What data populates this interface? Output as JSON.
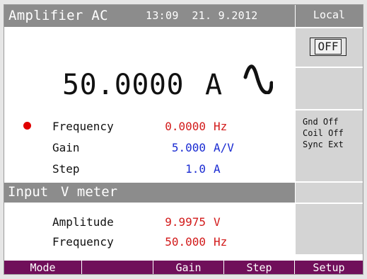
{
  "header": {
    "title": "Amplifier AC",
    "time": "13:09",
    "date": "21. 9.2012",
    "mode_label": "Local"
  },
  "output": {
    "value": "50.0000",
    "unit": "A",
    "waveform_icon": "sine-wave-icon",
    "state_button": "OFF"
  },
  "status": {
    "lines": [
      "Gnd Off",
      "Coil Off",
      "Sync Ext"
    ]
  },
  "parameters": [
    {
      "label": "Frequency",
      "value": "0.0000",
      "unit": "Hz",
      "color": "#d21a1a",
      "indicator": "red-dot-icon"
    },
    {
      "label": "Gain",
      "value": "5.000",
      "unit": "A/V",
      "color": "#1a2bd2"
    },
    {
      "label": "Step",
      "value": "1.0",
      "unit": "A",
      "color": "#1a2bd2"
    }
  ],
  "input_section": {
    "title": "Input",
    "subtitle": "V meter"
  },
  "measurements": [
    {
      "label": "Amplitude",
      "value": "9.9975",
      "unit": "V",
      "color": "#d21a1a"
    },
    {
      "label": "Frequency",
      "value": "50.000",
      "unit": "Hz",
      "color": "#d21a1a"
    }
  ],
  "softkeys": [
    "Mode",
    "",
    "Gain",
    "Step",
    "Setup"
  ],
  "colors": {
    "header_gray": "#8c8c8c",
    "panel_gray": "#d4d4d4",
    "softkey_purple": "#700f5a",
    "value_red": "#d21a1a",
    "value_blue": "#1a2bd2"
  }
}
